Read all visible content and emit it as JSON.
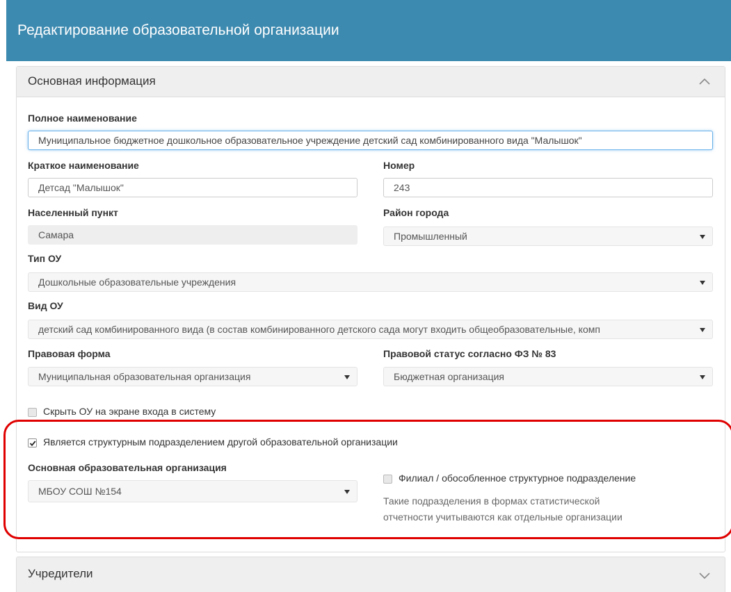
{
  "header": {
    "title": "Редактирование образовательной организации"
  },
  "main_section": {
    "title": "Основная информация",
    "toggle_icon": "chevron-up-icon"
  },
  "fields": {
    "full_name": {
      "label": "Полное наименование",
      "value": "Муниципальное бюджетное дошкольное образовательное учреждение детский сад комбинированного вида \"Малышок\""
    },
    "short_name": {
      "label": "Краткое наименование",
      "value": "Детсад \"Малышок\""
    },
    "number": {
      "label": "Номер",
      "value": "243"
    },
    "locality": {
      "label": "Населенный пункт",
      "value": "Самара"
    },
    "district": {
      "label": "Район города",
      "value": "Промышленный"
    },
    "org_type": {
      "label": "Тип ОУ",
      "value": "Дошкольные образовательные учреждения"
    },
    "org_kind": {
      "label": "Вид ОУ",
      "value": "детский сад комбинированного вида (в состав комбинированного детского сада могут входить общеобразовательные, комп"
    },
    "legal_form": {
      "label": "Правовая форма",
      "value": "Муниципальная образовательная организация"
    },
    "legal_status": {
      "label": "Правовой статус согласно ФЗ № 83",
      "value": "Бюджетная организация"
    },
    "parent_org": {
      "label": "Основная образовательная организация",
      "value": "МБОУ СОШ №154"
    }
  },
  "checkboxes": {
    "hide_on_login": {
      "label": "Скрыть ОУ на экране входа в систему",
      "checked": false
    },
    "is_structural_unit": {
      "label": "Является структурным подразделением другой образовательной организации",
      "checked": true
    },
    "branch": {
      "label": "Филиал / обособленное структурное подразделение",
      "checked": false
    }
  },
  "branch_note": {
    "line1": "Такие подразделения в формах статистической",
    "line2": "отчетности учитываются как отдельные организации"
  },
  "founders_section": {
    "title": "Учредители",
    "toggle_icon": "chevron-down-icon"
  },
  "colors": {
    "header_bg": "#3d8ab0",
    "highlight_frame": "#e00000",
    "focus_border": "#66afe9"
  }
}
